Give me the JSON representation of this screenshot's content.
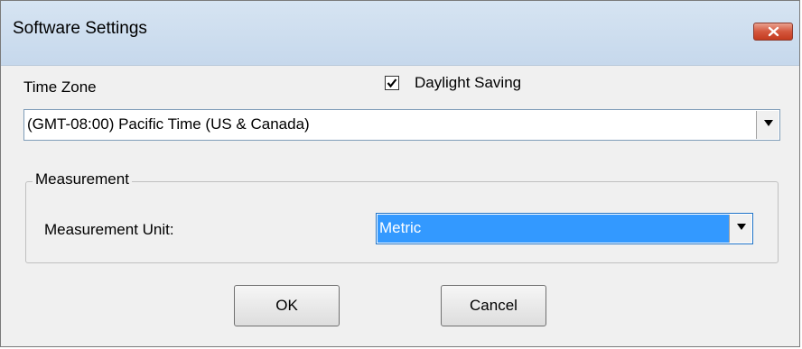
{
  "dialog": {
    "title": "Software Settings"
  },
  "time_zone": {
    "label": "Time Zone",
    "value": "(GMT-08:00) Pacific Time (US & Canada)"
  },
  "daylight_saving": {
    "label": "Daylight Saving",
    "checked": true
  },
  "measurement": {
    "group_label": "Measurement",
    "unit_label": "Measurement Unit:",
    "unit_value": "Metric"
  },
  "buttons": {
    "ok_label": "OK",
    "cancel_label": "Cancel"
  },
  "colors": {
    "selection": "#3399ff",
    "close_button": "#c43b1f"
  }
}
